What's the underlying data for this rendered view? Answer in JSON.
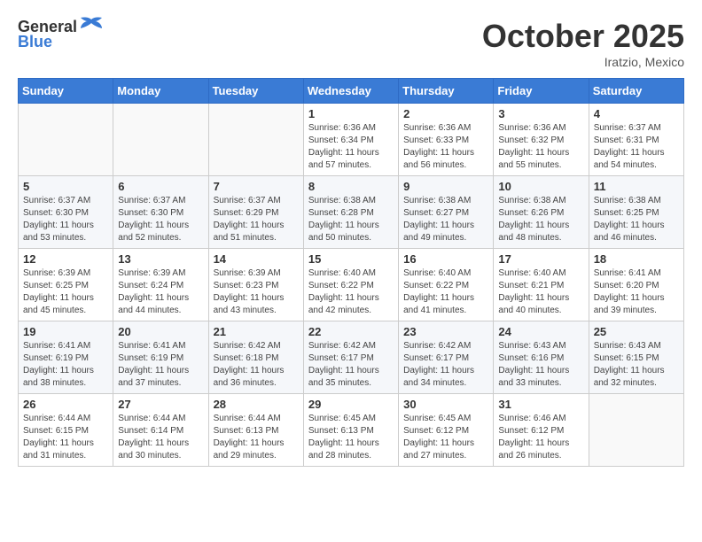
{
  "header": {
    "logo_general": "General",
    "logo_blue": "Blue",
    "month": "October 2025",
    "location": "Iratzio, Mexico"
  },
  "days_of_week": [
    "Sunday",
    "Monday",
    "Tuesday",
    "Wednesday",
    "Thursday",
    "Friday",
    "Saturday"
  ],
  "weeks": [
    [
      {
        "day": "",
        "content": ""
      },
      {
        "day": "",
        "content": ""
      },
      {
        "day": "",
        "content": ""
      },
      {
        "day": "1",
        "content": "Sunrise: 6:36 AM\nSunset: 6:34 PM\nDaylight: 11 hours and 57 minutes."
      },
      {
        "day": "2",
        "content": "Sunrise: 6:36 AM\nSunset: 6:33 PM\nDaylight: 11 hours and 56 minutes."
      },
      {
        "day": "3",
        "content": "Sunrise: 6:36 AM\nSunset: 6:32 PM\nDaylight: 11 hours and 55 minutes."
      },
      {
        "day": "4",
        "content": "Sunrise: 6:37 AM\nSunset: 6:31 PM\nDaylight: 11 hours and 54 minutes."
      }
    ],
    [
      {
        "day": "5",
        "content": "Sunrise: 6:37 AM\nSunset: 6:30 PM\nDaylight: 11 hours and 53 minutes."
      },
      {
        "day": "6",
        "content": "Sunrise: 6:37 AM\nSunset: 6:30 PM\nDaylight: 11 hours and 52 minutes."
      },
      {
        "day": "7",
        "content": "Sunrise: 6:37 AM\nSunset: 6:29 PM\nDaylight: 11 hours and 51 minutes."
      },
      {
        "day": "8",
        "content": "Sunrise: 6:38 AM\nSunset: 6:28 PM\nDaylight: 11 hours and 50 minutes."
      },
      {
        "day": "9",
        "content": "Sunrise: 6:38 AM\nSunset: 6:27 PM\nDaylight: 11 hours and 49 minutes."
      },
      {
        "day": "10",
        "content": "Sunrise: 6:38 AM\nSunset: 6:26 PM\nDaylight: 11 hours and 48 minutes."
      },
      {
        "day": "11",
        "content": "Sunrise: 6:38 AM\nSunset: 6:25 PM\nDaylight: 11 hours and 46 minutes."
      }
    ],
    [
      {
        "day": "12",
        "content": "Sunrise: 6:39 AM\nSunset: 6:25 PM\nDaylight: 11 hours and 45 minutes."
      },
      {
        "day": "13",
        "content": "Sunrise: 6:39 AM\nSunset: 6:24 PM\nDaylight: 11 hours and 44 minutes."
      },
      {
        "day": "14",
        "content": "Sunrise: 6:39 AM\nSunset: 6:23 PM\nDaylight: 11 hours and 43 minutes."
      },
      {
        "day": "15",
        "content": "Sunrise: 6:40 AM\nSunset: 6:22 PM\nDaylight: 11 hours and 42 minutes."
      },
      {
        "day": "16",
        "content": "Sunrise: 6:40 AM\nSunset: 6:22 PM\nDaylight: 11 hours and 41 minutes."
      },
      {
        "day": "17",
        "content": "Sunrise: 6:40 AM\nSunset: 6:21 PM\nDaylight: 11 hours and 40 minutes."
      },
      {
        "day": "18",
        "content": "Sunrise: 6:41 AM\nSunset: 6:20 PM\nDaylight: 11 hours and 39 minutes."
      }
    ],
    [
      {
        "day": "19",
        "content": "Sunrise: 6:41 AM\nSunset: 6:19 PM\nDaylight: 11 hours and 38 minutes."
      },
      {
        "day": "20",
        "content": "Sunrise: 6:41 AM\nSunset: 6:19 PM\nDaylight: 11 hours and 37 minutes."
      },
      {
        "day": "21",
        "content": "Sunrise: 6:42 AM\nSunset: 6:18 PM\nDaylight: 11 hours and 36 minutes."
      },
      {
        "day": "22",
        "content": "Sunrise: 6:42 AM\nSunset: 6:17 PM\nDaylight: 11 hours and 35 minutes."
      },
      {
        "day": "23",
        "content": "Sunrise: 6:42 AM\nSunset: 6:17 PM\nDaylight: 11 hours and 34 minutes."
      },
      {
        "day": "24",
        "content": "Sunrise: 6:43 AM\nSunset: 6:16 PM\nDaylight: 11 hours and 33 minutes."
      },
      {
        "day": "25",
        "content": "Sunrise: 6:43 AM\nSunset: 6:15 PM\nDaylight: 11 hours and 32 minutes."
      }
    ],
    [
      {
        "day": "26",
        "content": "Sunrise: 6:44 AM\nSunset: 6:15 PM\nDaylight: 11 hours and 31 minutes."
      },
      {
        "day": "27",
        "content": "Sunrise: 6:44 AM\nSunset: 6:14 PM\nDaylight: 11 hours and 30 minutes."
      },
      {
        "day": "28",
        "content": "Sunrise: 6:44 AM\nSunset: 6:13 PM\nDaylight: 11 hours and 29 minutes."
      },
      {
        "day": "29",
        "content": "Sunrise: 6:45 AM\nSunset: 6:13 PM\nDaylight: 11 hours and 28 minutes."
      },
      {
        "day": "30",
        "content": "Sunrise: 6:45 AM\nSunset: 6:12 PM\nDaylight: 11 hours and 27 minutes."
      },
      {
        "day": "31",
        "content": "Sunrise: 6:46 AM\nSunset: 6:12 PM\nDaylight: 11 hours and 26 minutes."
      },
      {
        "day": "",
        "content": ""
      }
    ]
  ]
}
